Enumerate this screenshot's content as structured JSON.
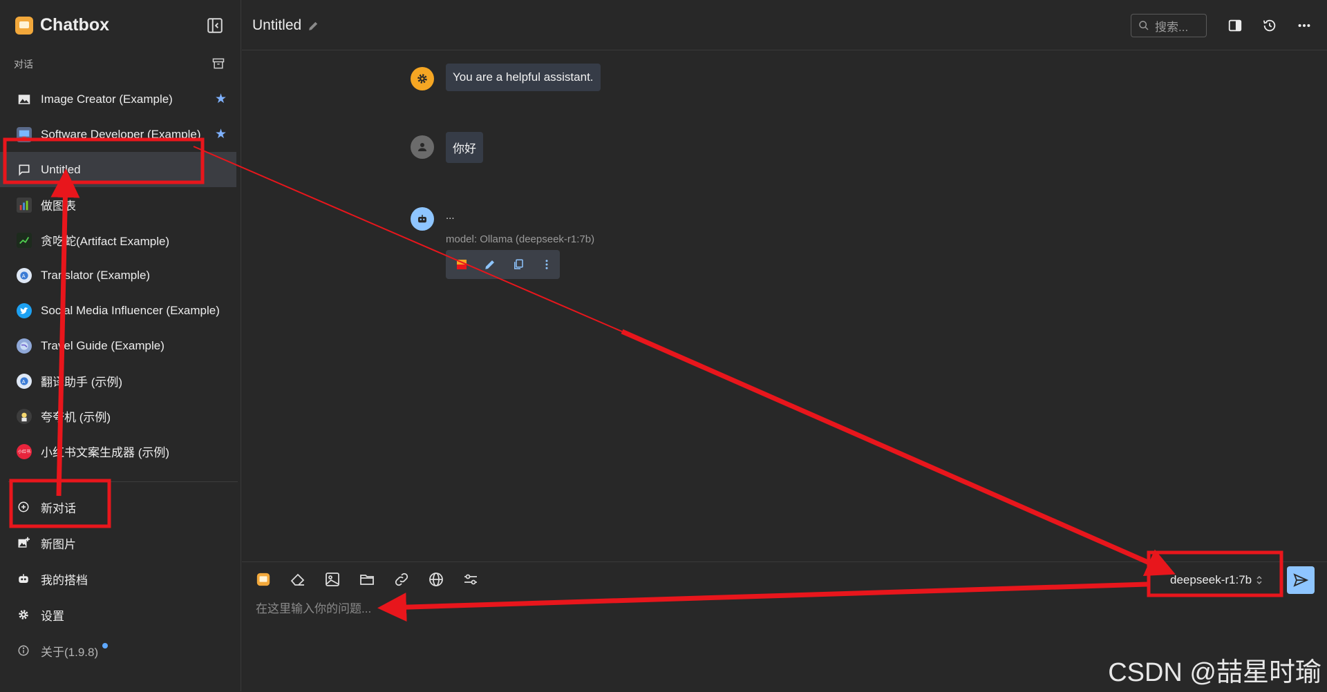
{
  "app": {
    "name": "Chatbox"
  },
  "sidebar": {
    "section_label": "对话",
    "conversations": [
      {
        "label": "Image Creator (Example)",
        "icon": "image-icon",
        "starred": true
      },
      {
        "label": "Software Developer (Example)",
        "icon": "developer-avatar-icon",
        "starred": true
      },
      {
        "label": "Untitled",
        "icon": "chat-bubble-icon",
        "active": true
      },
      {
        "label": "做图表",
        "icon": "chart-avatar-icon"
      },
      {
        "label": "贪吃蛇(Artifact Example)",
        "icon": "snake-game-icon"
      },
      {
        "label": "Translator (Example)",
        "icon": "translator-avatar-icon"
      },
      {
        "label": "Social Media Influencer (Example)",
        "icon": "twitter-bird-icon"
      },
      {
        "label": "Travel Guide (Example)",
        "icon": "globe-avatar-icon"
      },
      {
        "label": "翻译助手 (示例)",
        "icon": "translator-avatar-icon"
      },
      {
        "label": "夸夸机 (示例)",
        "icon": "cheer-avatar-icon"
      },
      {
        "label": "小红书文案生成器 (示例)",
        "icon": "xiaohongshu-logo-icon",
        "badge_text": "小红书"
      }
    ],
    "actions": [
      {
        "label": "新对话",
        "icon": "plus-circle-icon"
      },
      {
        "label": "新图片",
        "icon": "add-image-icon"
      },
      {
        "label": "我的搭档",
        "icon": "bot-icon"
      },
      {
        "label": "设置",
        "icon": "gear-icon"
      },
      {
        "label": "关于(1.9.8)",
        "icon": "info-icon"
      }
    ]
  },
  "header": {
    "title": "Untitled",
    "search_placeholder": "搜索..."
  },
  "messages": [
    {
      "role": "system",
      "text": "You are a helpful assistant.",
      "avatar_icon": "gear-icon",
      "avatar_color": "#f5a623"
    },
    {
      "role": "user",
      "text": "你好",
      "avatar_icon": "user-icon",
      "avatar_color": "#6b6b6b"
    },
    {
      "role": "assistant",
      "text": "...",
      "model_label": "model: Ollama (deepseek-r1:7b)",
      "avatar_icon": "bot-icon",
      "avatar_color": "#8ec5ff"
    }
  ],
  "composer": {
    "model": "deepseek-r1:7b",
    "placeholder": "在这里输入你的问题..."
  },
  "watermark": "CSDN @喆星时瑜",
  "colors": {
    "accent": "#8ec5ff",
    "annotation": "#e8161c",
    "star": "#7fb2ff"
  }
}
